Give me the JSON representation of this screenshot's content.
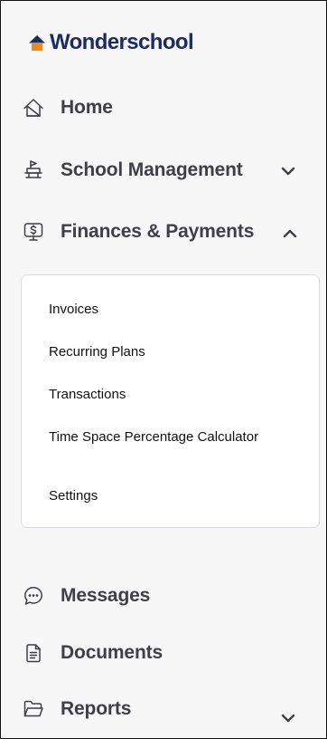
{
  "brand": {
    "name": "Wonderschool",
    "icon": "house-logo-icon",
    "colors": {
      "navy": "#1b2b65",
      "orange": "#ee8a1d"
    }
  },
  "nav": [
    {
      "id": "home",
      "label": "Home",
      "icon": "home-icon"
    },
    {
      "id": "school-management",
      "label": "School Management",
      "icon": "school-management-icon",
      "chevron": "chevron-down-icon"
    },
    {
      "id": "finances-payments",
      "label": "Finances & Payments",
      "icon": "dollar-sign-icon",
      "chevron": "chevron-up-icon",
      "expanded": true
    },
    {
      "id": "messages",
      "label": "Messages",
      "icon": "chat-bubble-icon"
    },
    {
      "id": "documents",
      "label": "Documents",
      "icon": "document-icon"
    },
    {
      "id": "reports",
      "label": "Reports",
      "icon": "folder-icon",
      "chevron": "chevron-down-icon"
    }
  ],
  "finances_submenu": [
    {
      "label": "Invoices"
    },
    {
      "label": "Recurring Plans"
    },
    {
      "label": "Transactions"
    },
    {
      "label": "Time Space Percentage Calculator"
    },
    {
      "label": "Settings"
    }
  ]
}
